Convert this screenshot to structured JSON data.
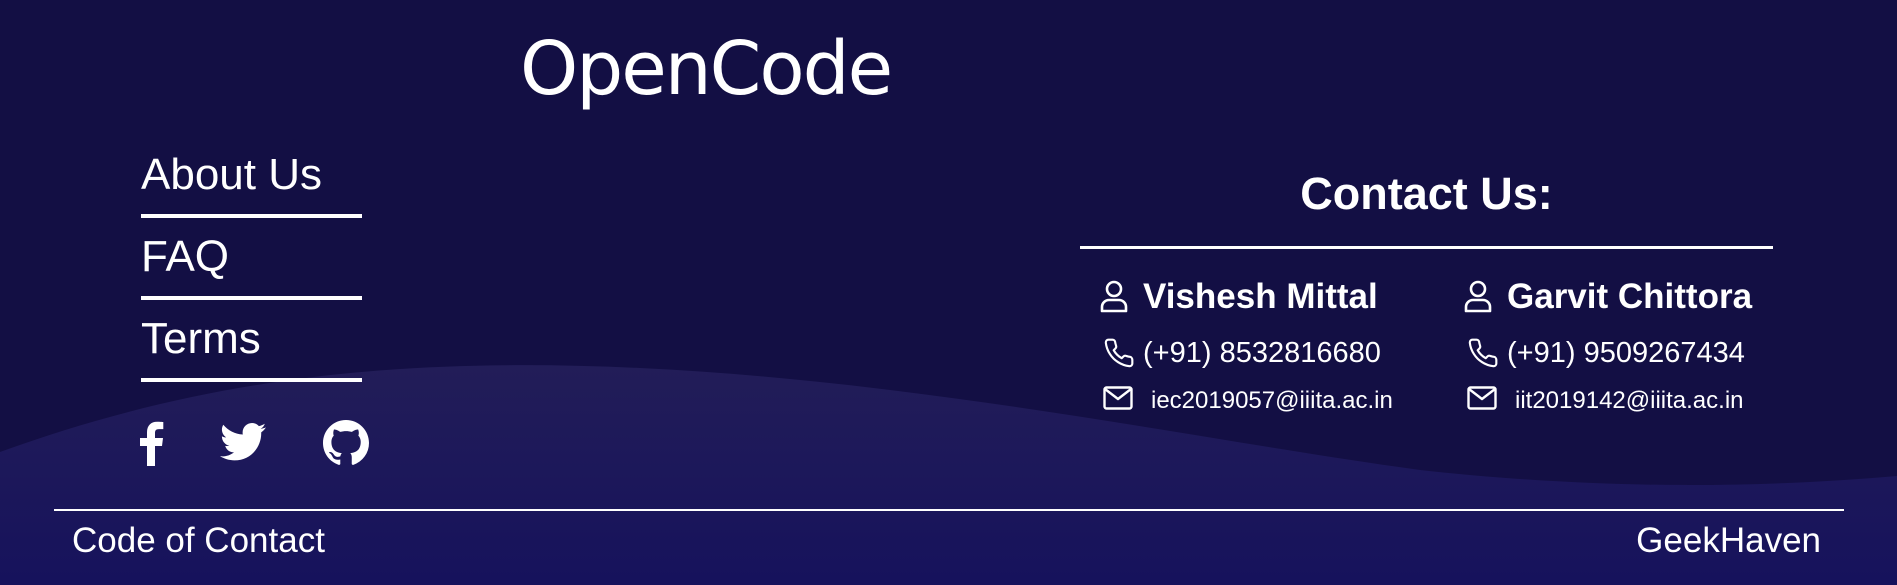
{
  "brand": {
    "logo_text": "OpenCode"
  },
  "nav_links": [
    {
      "label": "About Us"
    },
    {
      "label": "FAQ"
    },
    {
      "label": "Terms"
    }
  ],
  "social": [
    {
      "icon": "facebook-icon"
    },
    {
      "icon": "twitter-icon"
    },
    {
      "icon": "github-icon"
    }
  ],
  "contact": {
    "title": "Contact Us:",
    "people": [
      {
        "name": "Vishesh Mittal",
        "phone": "(+91) 8532816680",
        "email": "iec2019057@iiita.ac.in"
      },
      {
        "name": "Garvit Chittora",
        "phone": "(+91) 9509267434",
        "email": "iit2019142@iiita.ac.in"
      }
    ]
  },
  "bottom_bar": {
    "left": "Code of Contact",
    "right": "GeekHaven"
  },
  "colors": {
    "background": "#130f44",
    "wave": "#1f1b5a",
    "text": "#ffffff"
  }
}
